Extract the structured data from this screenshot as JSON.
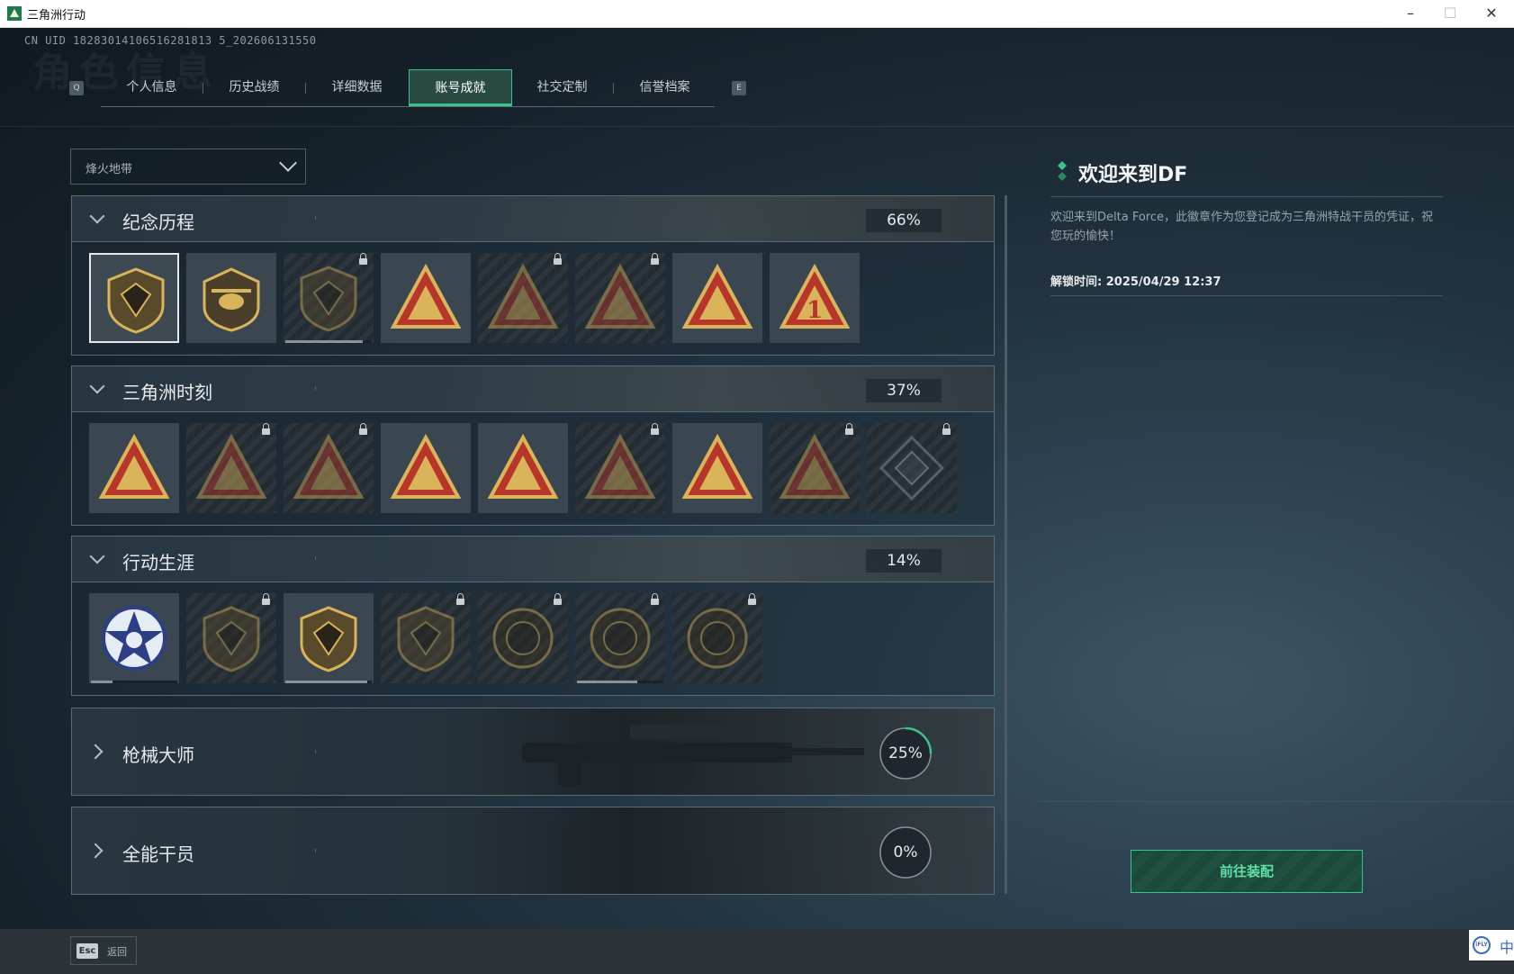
{
  "window": {
    "title": "三角洲行动",
    "minimize": "–",
    "maximize": "☐",
    "close": "✕"
  },
  "uid_text": "CN UID 18283014106516281813 5_202606131550",
  "ghost_title": "角色信息",
  "tabs": {
    "left_key": "Q",
    "right_key": "E",
    "items": [
      {
        "label": "个人信息"
      },
      {
        "label": "历史战绩"
      },
      {
        "label": "详细数据"
      },
      {
        "label": "账号成就",
        "active": true
      },
      {
        "label": "社交定制"
      },
      {
        "label": "信誉档案"
      }
    ]
  },
  "mode_dropdown": {
    "value": "烽火地带"
  },
  "categories": [
    {
      "name": "纪念历程",
      "percent": "66%",
      "percent_value": 66,
      "expanded": true,
      "badges": [
        {
          "icon": "delta-shield-badge",
          "locked": false,
          "selected": true
        },
        {
          "icon": "helicopter-badge",
          "locked": false
        },
        {
          "icon": "hex-emblem-badge",
          "locked": true,
          "progress": 0.9
        },
        {
          "icon": "s9-mech-badge",
          "locked": false
        },
        {
          "icon": "hooded-operator-badge",
          "locked": true
        },
        {
          "icon": "crossed-swords-badge",
          "locked": true
        },
        {
          "icon": "gold-bars-badge",
          "locked": false
        },
        {
          "icon": "number-one-badge",
          "locked": false
        }
      ]
    },
    {
      "name": "三角洲时刻",
      "percent": "37%",
      "percent_value": 37,
      "expanded": true,
      "badges": [
        {
          "icon": "usb-drive-badge",
          "locked": false
        },
        {
          "icon": "vault-badge",
          "locked": true
        },
        {
          "icon": "kneeling-soldier-badge",
          "locked": true
        },
        {
          "icon": "dice-badge",
          "locked": false
        },
        {
          "icon": "squad-badge",
          "locked": false
        },
        {
          "icon": "armored-beast-badge",
          "locked": true
        },
        {
          "icon": "rocket-launch-badge",
          "locked": false
        },
        {
          "icon": "dragon-badge",
          "locked": true
        },
        {
          "icon": "diamond-crest-badge",
          "locked": true
        }
      ]
    },
    {
      "name": "行动生涯",
      "percent": "14%",
      "percent_value": 14,
      "expanded": true,
      "badges": [
        {
          "icon": "star-wreath-badge",
          "locked": false,
          "progress": 0.25
        },
        {
          "icon": "wing-shield-badge",
          "locked": true
        },
        {
          "icon": "split-shield-badge",
          "locked": false,
          "progress": 0.95
        },
        {
          "icon": "hex-shield-badge",
          "locked": true
        },
        {
          "icon": "oyster-medal-badge",
          "locked": true
        },
        {
          "icon": "skull-medal-badge",
          "locked": true,
          "progress": 0.7
        },
        {
          "icon": "eye-medal-badge",
          "locked": true
        }
      ]
    },
    {
      "name": "枪械大师",
      "percent": "25%",
      "percent_value": 25,
      "expanded": false
    },
    {
      "name": "全能干员",
      "percent": "0%",
      "percent_value": 0,
      "expanded": false
    }
  ],
  "detail": {
    "title": "欢迎来到DF",
    "description": "欢迎来到Delta Force，此徽章作为您登记成为三角洲特战干员的凭证，祝您玩的愉快！",
    "unlock_time": "解锁时间: 2025/04/29 12:37",
    "equip_button": "前往装配"
  },
  "footer": {
    "esc_key": "Esc",
    "back_label": "返回"
  },
  "ime": {
    "label": "中",
    "logo": "iFLY"
  },
  "colors": {
    "accent": "#3ec08a",
    "badge_red": "#b8352a",
    "badge_gold": "#d9b45a"
  }
}
